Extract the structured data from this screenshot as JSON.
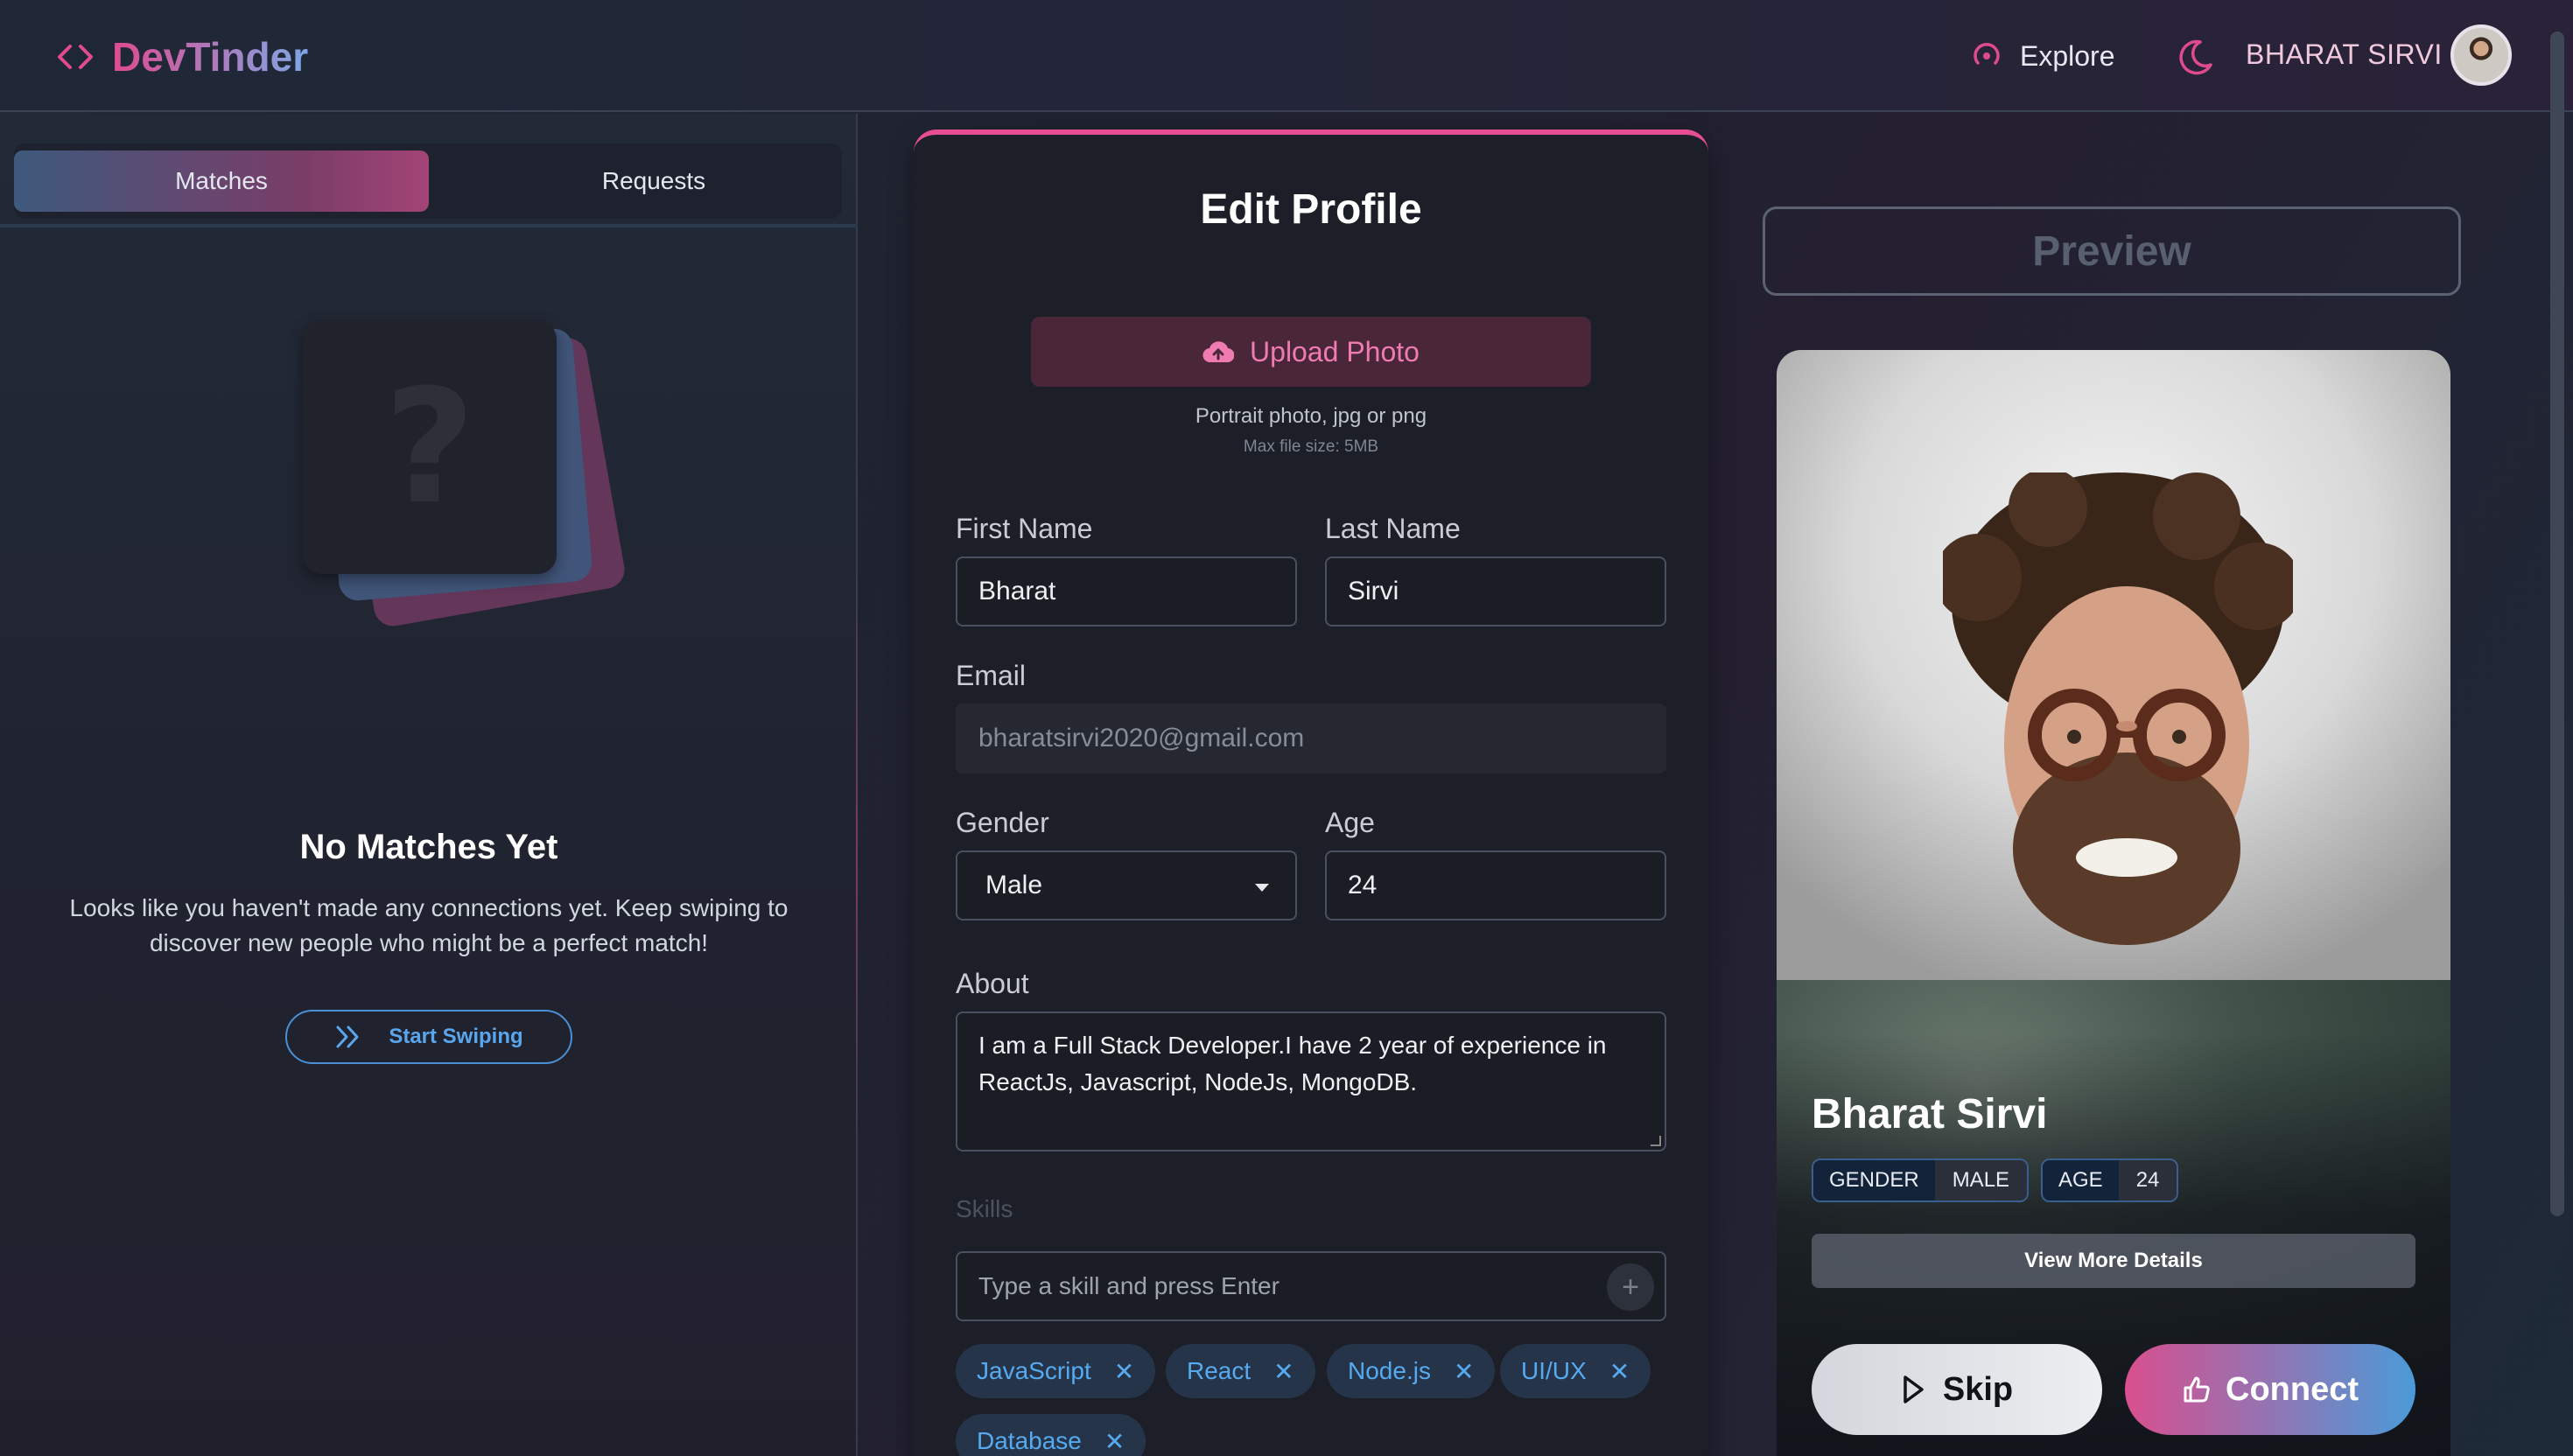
{
  "brand": {
    "name": "DevTinder"
  },
  "nav": {
    "explore_label": "Explore",
    "username": "BHARAT SIRVI"
  },
  "sidebar": {
    "tabs": [
      {
        "label": "Matches",
        "active": true
      },
      {
        "label": "Requests",
        "active": false
      }
    ],
    "empty_title": "No Matches Yet",
    "empty_text": "Looks like you haven't made any connections yet. Keep swiping to discover new people who might be a perfect match!",
    "start_button": "Start Swiping",
    "placeholder_glyph": "?"
  },
  "edit_profile": {
    "title": "Edit Profile",
    "upload_label": "Upload Photo",
    "upload_hint": "Portrait photo, jpg or png",
    "upload_limit": "Max file size: 5MB",
    "first_name": {
      "label": "First Name",
      "value": "Bharat"
    },
    "last_name": {
      "label": "Last Name",
      "value": "Sirvi"
    },
    "email": {
      "label": "Email",
      "value": "bharatsirvi2020@gmail.com"
    },
    "gender": {
      "label": "Gender",
      "value": "Male"
    },
    "age": {
      "label": "Age",
      "value": "24"
    },
    "about": {
      "label": "About",
      "value": "I am a Full Stack Developer.I have 2 year of experience in ReactJs, Javascript, NodeJs, MongoDB."
    },
    "skills": {
      "label": "Skills",
      "placeholder": "Type a skill and press Enter",
      "add_symbol": "+",
      "items": [
        "JavaScript",
        "React",
        "Node.js",
        "UI/UX",
        "Database"
      ]
    }
  },
  "preview": {
    "button_label": "Preview",
    "name": "Bharat Sirvi",
    "tags": [
      {
        "key": "GENDER",
        "value": "MALE"
      },
      {
        "key": "AGE",
        "value": "24"
      }
    ],
    "more_label": "View More Details",
    "skip_label": "Skip",
    "connect_label": "Connect"
  },
  "colors": {
    "accent_pink": "#e64d92",
    "accent_blue": "#55aaf0",
    "background": "#1f2330"
  },
  "icons": [
    "code-brackets-icon",
    "explore-radar-icon",
    "moon-icon",
    "cloud-upload-icon",
    "chevrons-right-icon",
    "play-icon",
    "thumbs-up-icon",
    "close-icon",
    "plus-icon",
    "caret-down-icon"
  ]
}
